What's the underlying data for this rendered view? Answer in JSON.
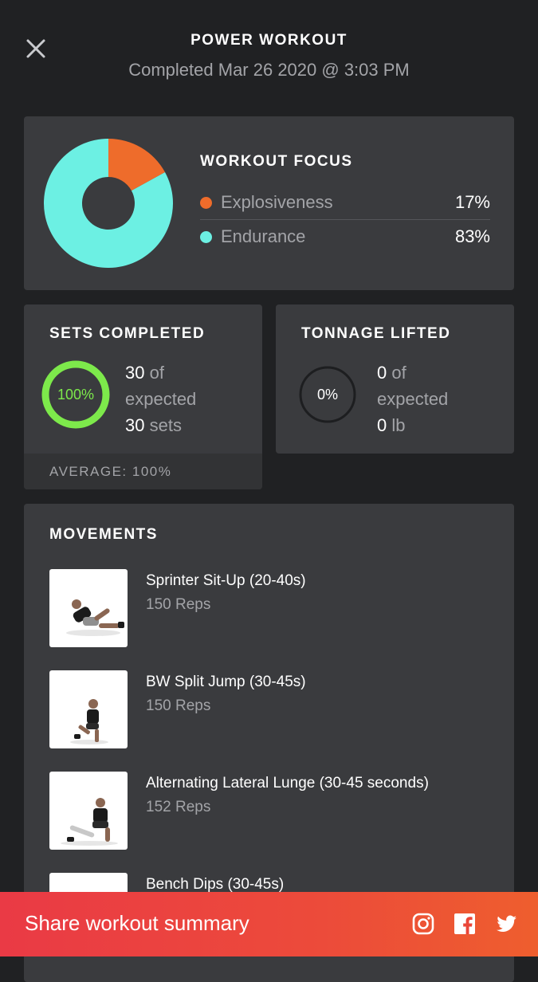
{
  "header": {
    "title": "POWER WORKOUT",
    "subtitle": "Completed Mar 26 2020 @ 3:03 PM",
    "close_icon": "close-icon"
  },
  "focus": {
    "heading": "WORKOUT FOCUS",
    "items": [
      {
        "label": "Explosiveness",
        "percent": "17%",
        "value": 17,
        "color": "#ee6c2b"
      },
      {
        "label": "Endurance",
        "percent": "83%",
        "value": 83,
        "color": "#6cf0e3"
      }
    ]
  },
  "sets": {
    "heading": "SETS COMPLETED",
    "ring_label": "100%",
    "ring_value": 100,
    "ring_color": "#7de94b",
    "count": "30",
    "of": "of",
    "expected": "expected",
    "total": "30",
    "unit": "sets",
    "footer": "AVERAGE: 100%"
  },
  "tonnage": {
    "heading": "TONNAGE LIFTED",
    "ring_label": "0%",
    "ring_value": 0,
    "count": "0",
    "of": "of",
    "expected": "expected",
    "total": "0",
    "unit": "lb"
  },
  "movements": {
    "heading": "MOVEMENTS",
    "items": [
      {
        "name": "Sprinter Sit-Up (20-40s)",
        "reps": "150 Reps"
      },
      {
        "name": "BW Split Jump (30-45s)",
        "reps": "150 Reps"
      },
      {
        "name": "Alternating Lateral Lunge (30-45 seconds)",
        "reps": "152 Reps"
      },
      {
        "name": "Bench Dips (30-45s)",
        "reps": ""
      }
    ]
  },
  "share": {
    "label": "Share workout summary",
    "icons": [
      "instagram-icon",
      "facebook-icon",
      "twitter-icon"
    ]
  }
}
